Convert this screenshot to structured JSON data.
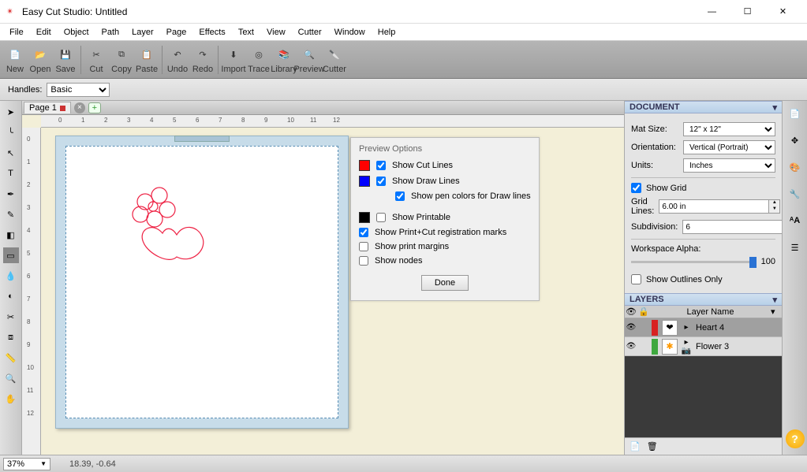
{
  "window": {
    "title": "Easy Cut Studio: Untitled"
  },
  "menus": [
    "File",
    "Edit",
    "Object",
    "Path",
    "Layer",
    "Page",
    "Effects",
    "Text",
    "View",
    "Cutter",
    "Window",
    "Help"
  ],
  "toolbar": [
    "New",
    "Open",
    "Save",
    "Cut",
    "Copy",
    "Paste",
    "Undo",
    "Redo",
    "Import",
    "Trace",
    "Library",
    "Preview",
    "Cutter"
  ],
  "handles": {
    "label": "Handles:",
    "value": "Basic"
  },
  "tab": {
    "label": "Page 1"
  },
  "ruler_h": [
    "0",
    "1",
    "2",
    "3",
    "4",
    "5",
    "6",
    "7",
    "8",
    "9",
    "10",
    "11",
    "12"
  ],
  "ruler_v": [
    "0",
    "1",
    "2",
    "3",
    "4",
    "5",
    "6",
    "7",
    "8",
    "9",
    "10",
    "11",
    "12"
  ],
  "preview": {
    "title": "Preview Options",
    "cut_lines": "Show Cut Lines",
    "draw_lines": "Show Draw Lines",
    "pen_colors": "Show pen colors for Draw lines",
    "printable": "Show Printable",
    "reg_marks": "Show Print+Cut registration marks",
    "print_margins": "Show print margins",
    "nodes": "Show nodes",
    "done": "Done"
  },
  "doc": {
    "header": "DOCUMENT",
    "mat_size_lbl": "Mat Size:",
    "mat_size": "12\" x 12\"",
    "orient_lbl": "Orientation:",
    "orient": "Vertical (Portrait)",
    "units_lbl": "Units:",
    "units": "Inches",
    "show_grid": "Show Grid",
    "grid_lines_lbl": "Grid Lines:",
    "grid_lines": "6.00 in",
    "subdiv_lbl": "Subdivision:",
    "subdiv": "6",
    "alpha_lbl": "Workspace Alpha:",
    "alpha_val": "100",
    "outlines": "Show Outlines Only"
  },
  "layers": {
    "header": "LAYERS",
    "col": "Layer Name",
    "items": [
      {
        "name": "Heart 4",
        "color": "#d82222"
      },
      {
        "name": "Flower 3",
        "color": "#3fa83f"
      }
    ]
  },
  "status": {
    "zoom": "37%",
    "coords": "18.39, -0.64"
  }
}
